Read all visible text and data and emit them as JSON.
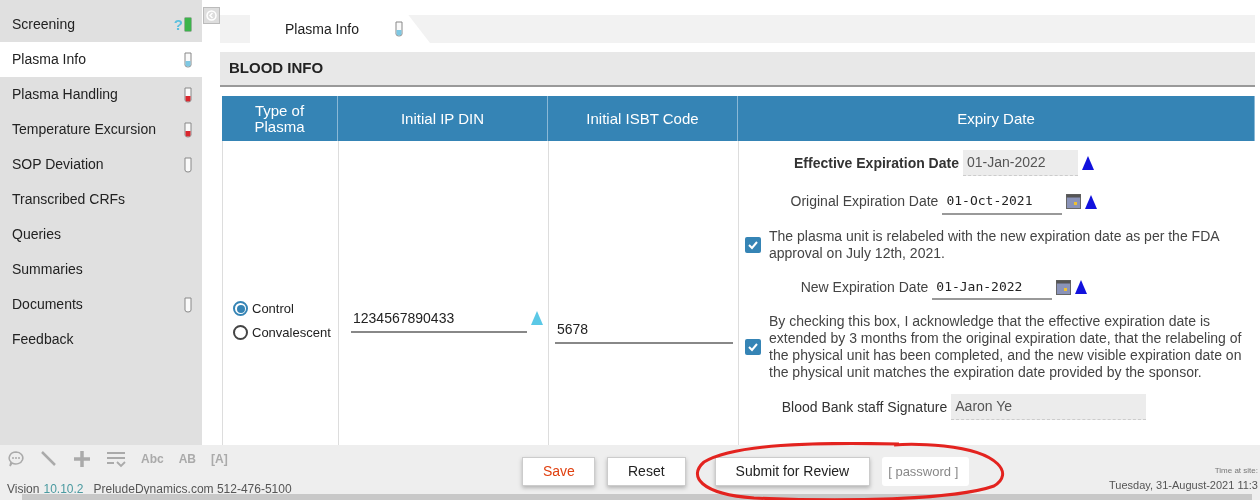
{
  "sidebar": {
    "items": [
      {
        "label": "Screening",
        "selected": false,
        "kind": "query",
        "query_mark": "?"
      },
      {
        "label": "Plasma Info",
        "selected": true,
        "kind": "tube-blue"
      },
      {
        "label": "Plasma Handling",
        "selected": false,
        "kind": "tube-red"
      },
      {
        "label": "Temperature Excursion",
        "selected": false,
        "kind": "tube-red"
      },
      {
        "label": "SOP Deviation",
        "selected": false,
        "kind": "tube-empty"
      },
      {
        "label": "Transcribed CRFs",
        "selected": false,
        "kind": "plain"
      },
      {
        "label": "Queries",
        "selected": false,
        "kind": "plain"
      },
      {
        "label": "Summaries",
        "selected": false,
        "kind": "plain"
      },
      {
        "label": "Documents",
        "selected": false,
        "kind": "tube-empty"
      },
      {
        "label": "Feedback",
        "selected": false,
        "kind": "plain"
      }
    ]
  },
  "tab": {
    "label": "Plasma Info",
    "selected": true,
    "kind": "tube-blue"
  },
  "section": {
    "title": "BLOOD INFO"
  },
  "table": {
    "columns": [
      "Type of Plasma",
      "Initial IP DIN",
      "Initial ISBT Code",
      "Expiry Date"
    ],
    "plasma_type": [
      {
        "label": "Control",
        "selected": true
      },
      {
        "label": "Convalescent",
        "selected": false
      }
    ],
    "initial_ip_din": "1234567890433",
    "initial_isbt_code": "5678",
    "expiry": [
      {
        "kind": "readonly",
        "label": "Effective Expiration Date",
        "value": "01-Jan-2022",
        "bold": true
      },
      {
        "kind": "date",
        "label": "Original Expiration Date",
        "value": "01-Oct-2021"
      },
      {
        "kind": "checkbox",
        "text": "The plasma unit is relabeled with the new expiration date as per the FDA approval on July 12th, 2021.",
        "checked": true
      },
      {
        "kind": "date",
        "label": "New Expiration Date",
        "value": "01-Jan-2022"
      },
      {
        "kind": "checkbox",
        "text": "By checking this box, I acknowledge that the effective expiration date is extended by 3 months from the original expiration date, that the relabeling of the physical unit has been completed, and the new visible expiration date on the physical unit matches the expiration date provided by the sponsor.",
        "checked": true
      },
      {
        "kind": "signature",
        "label": "Blood Bank staff Signature",
        "value": "Aaron Ye"
      }
    ]
  },
  "toolbar": {
    "text_buttons": [
      "Abc",
      "AB",
      "[A]"
    ]
  },
  "footer": {
    "product": "Vision",
    "version": "10.10.2",
    "contact": "PreludeDynamics.com 512-476-5100"
  },
  "buttons": [
    {
      "label": "Save",
      "kind": "save"
    },
    {
      "label": "Reset",
      "kind": "plain"
    },
    {
      "label": "Submit for Review",
      "kind": "plain"
    }
  ],
  "password": {
    "placeholder": "[ password ]"
  },
  "time": {
    "label": "Time at site:",
    "value": "Tuesday, 31-August-2021 11:3"
  }
}
